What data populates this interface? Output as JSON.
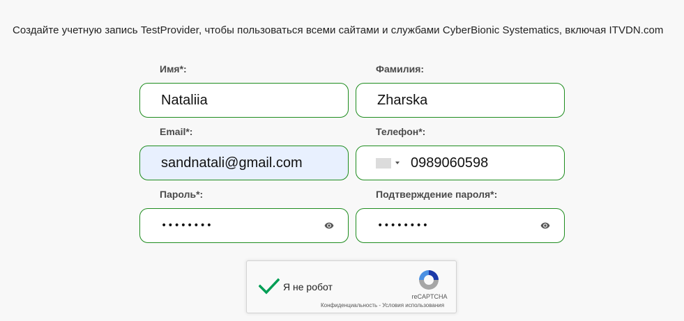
{
  "intro_text": "Создайте учетную запись TestProvider, чтобы пользоваться всеми сайтами и службами CyberBionic Systematics, включая ITVDN.com",
  "form": {
    "first_name": {
      "label": "Имя*:",
      "value": "Nataliia"
    },
    "last_name": {
      "label": "Фамилия:",
      "value": "Zharska"
    },
    "email": {
      "label": "Email*:",
      "value": "sandnatali@gmail.com"
    },
    "phone": {
      "label": "Телефон*:",
      "value": "0989060598"
    },
    "password": {
      "label": "Пароль*:",
      "value": "••••••••"
    },
    "password_confirm": {
      "label": "Подтверждение пароля*:",
      "value": "••••••••"
    }
  },
  "recaptcha": {
    "checkbox_label": "Я не робот",
    "brand": "reCAPTCHA",
    "links": "Конфиденциальность - Условия использования",
    "checked": true
  },
  "colors": {
    "field_border": "#1e8c1e",
    "autofill_bg": "#e8f0fe",
    "check_green": "#009e55",
    "page_bg": "#f8f8f8"
  }
}
